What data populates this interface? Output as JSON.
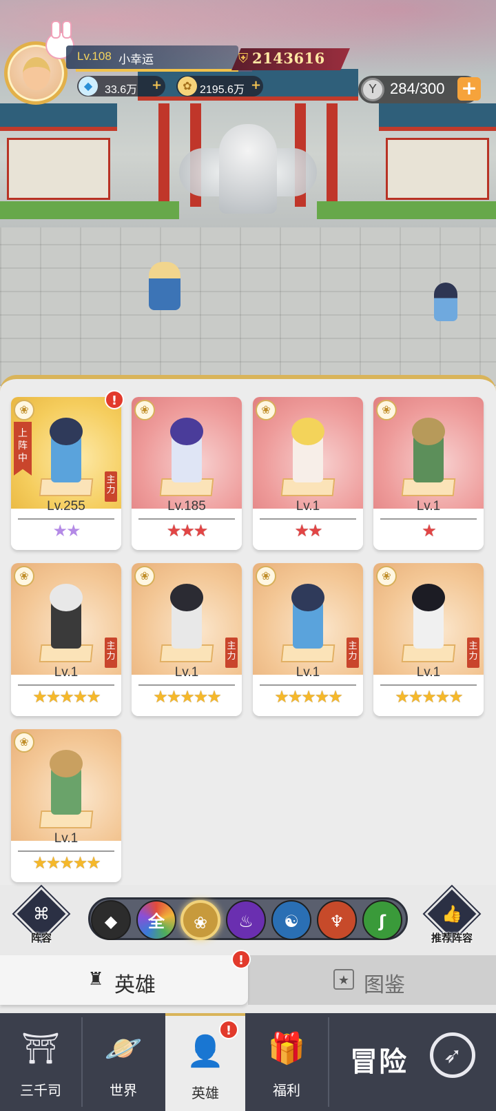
{
  "hud": {
    "level": "Lv.108",
    "player_name": "小幸运",
    "power": "2143616",
    "diamonds": "33.6万",
    "gold": "2195.6万",
    "stamina": "284/300",
    "exp_fraction": 0.92
  },
  "heroes": [
    {
      "level": "Lv.255",
      "stars": "★★",
      "star_color": "purple",
      "bg": "gold",
      "deployed": true,
      "deployed_label": "上阵中",
      "main": true,
      "main_label": "主力",
      "alert": true
    },
    {
      "level": "Lv.185",
      "stars": "★★★",
      "star_color": "red",
      "bg": "red",
      "main": false
    },
    {
      "level": "Lv.1",
      "stars": "★★",
      "star_color": "red",
      "bg": "red",
      "main": false
    },
    {
      "level": "Lv.1",
      "stars": "★",
      "star_color": "red",
      "bg": "red",
      "main": false
    },
    {
      "level": "Lv.1",
      "stars": "★★★★★",
      "star_color": "gold",
      "bg": "orange",
      "main": true,
      "main_label": "主力"
    },
    {
      "level": "Lv.1",
      "stars": "★★★★★",
      "star_color": "gold",
      "bg": "orange",
      "main": true,
      "main_label": "主力"
    },
    {
      "level": "Lv.1",
      "stars": "★★★★★",
      "star_color": "gold",
      "bg": "orange",
      "main": true,
      "main_label": "主力"
    },
    {
      "level": "Lv.1",
      "stars": "★★★★★",
      "star_color": "gold",
      "bg": "orange",
      "main": true,
      "main_label": "主力"
    },
    {
      "level": "Lv.1",
      "stars": "★★★★★",
      "star_color": "gold",
      "bg": "orange",
      "main": false
    }
  ],
  "filters": {
    "lineup_label": "阵容",
    "recommend_label": "推荐阵容",
    "all_label": "全",
    "active": "lotus"
  },
  "tabs": {
    "hero": "英雄",
    "codex": "图鉴"
  },
  "nav": {
    "home": "三千司",
    "world": "世界",
    "hero": "英雄",
    "welfare": "福利",
    "adventure": "冒险"
  },
  "colors": {
    "accent_gold": "#d9b45a",
    "alert_red": "#e23a2c",
    "main_tag": "#c9452c"
  }
}
